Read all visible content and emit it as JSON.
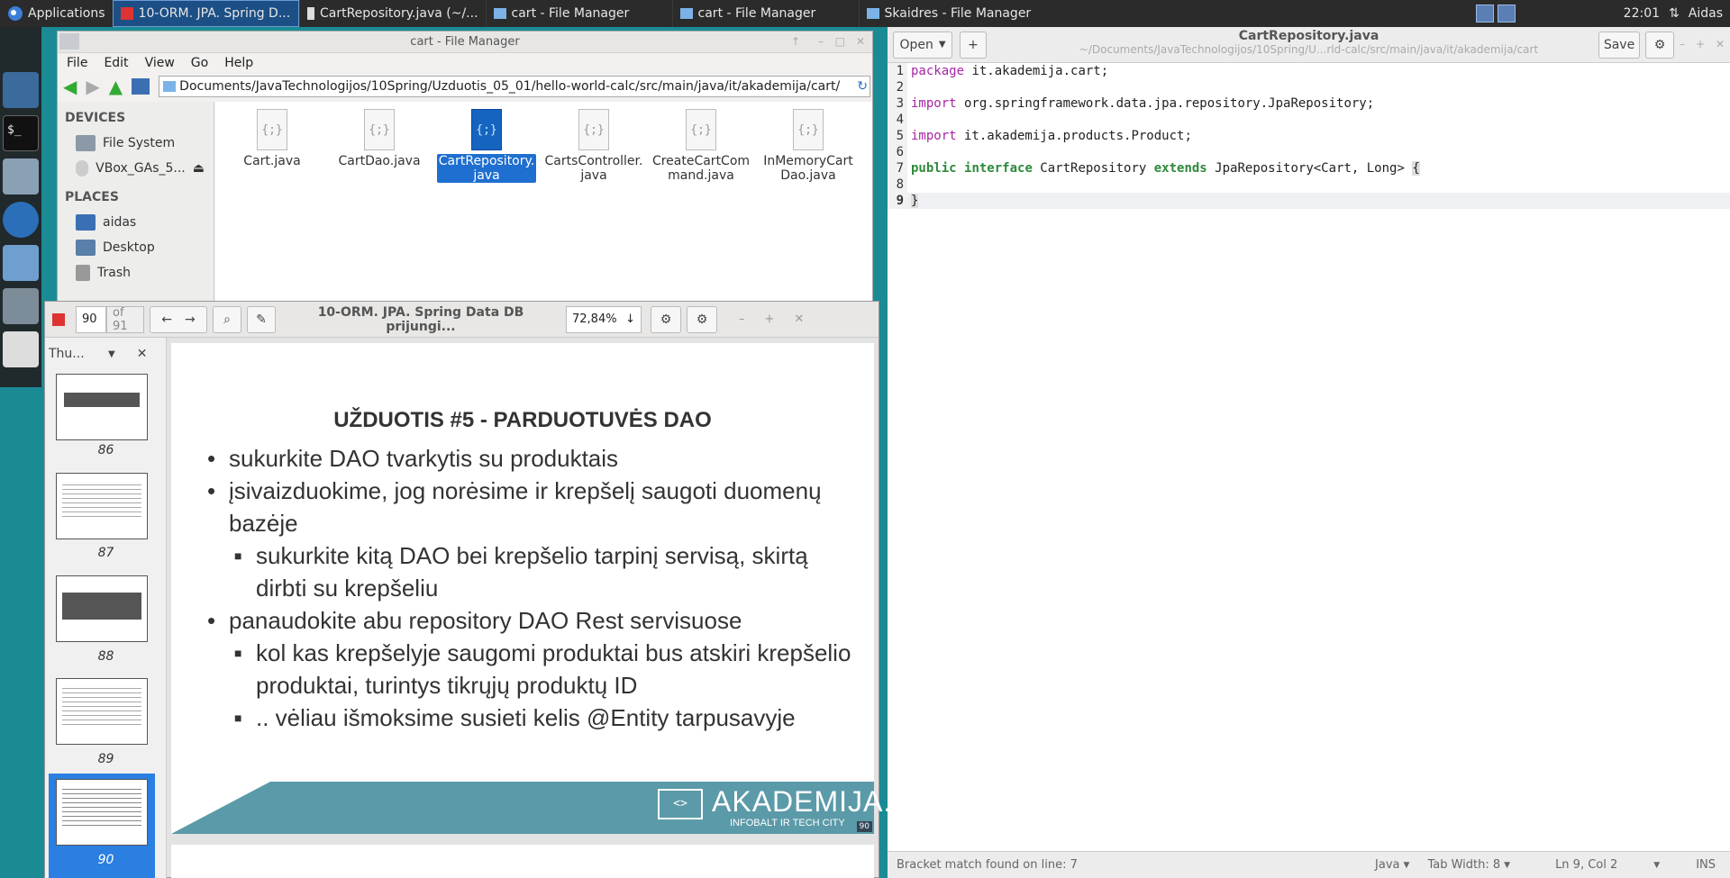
{
  "panel": {
    "apps": "Applications",
    "tasks": [
      "10-ORM. JPA. Spring D...",
      "CartRepository.java (~/...",
      "cart - File Manager",
      "cart - File Manager",
      "Skaidres - File Manager"
    ],
    "clock": "22:01",
    "user": "Aidas"
  },
  "fm": {
    "title": "cart - File Manager",
    "menu": [
      "File",
      "Edit",
      "View",
      "Go",
      "Help"
    ],
    "path": "Documents/JavaTechnologijos/10Spring/Uzduotis_05_01/hello-world-calc/src/main/java/it/akademija/cart/",
    "devices_header": "DEVICES",
    "places_header": "PLACES",
    "devices": [
      "File System",
      "VBox_GAs_5..."
    ],
    "places": [
      "aidas",
      "Desktop",
      "Trash"
    ],
    "file_icon_glyph": "{;}",
    "files": [
      "Cart.java",
      "CartDao.java",
      "CartRepository.java",
      "CartsController.java",
      "CreateCartCommand.java",
      "InMemoryCartDao.java"
    ]
  },
  "editor": {
    "title": "CartRepository.java",
    "subtitle": "~/Documents/JavaTechnologijos/10Spring/U...rld-calc/src/main/java/it/akademija/cart",
    "open": "Open",
    "save": "Save",
    "lines": [
      "package it.akademija.cart;",
      "",
      "import org.springframework.data.jpa.repository.JpaRepository;",
      "",
      "import it.akademija.products.Product;",
      "",
      "public interface CartRepository extends JpaRepository<Cart, Long> {",
      "",
      "}"
    ],
    "status": {
      "msg": "Bracket match found on line: 7",
      "lang": "Java",
      "tab": "Tab Width: 8",
      "pos": "Ln 9, Col 2",
      "ins": "INS"
    }
  },
  "pdf": {
    "page": "90",
    "of": "of 91",
    "title": "10-ORM. JPA. Spring Data DB prijungi...",
    "zoom": "72,84%",
    "side_label": "Thu...",
    "thumbs": [
      "86",
      "87",
      "88",
      "89",
      "90"
    ],
    "slide": {
      "heading": "UŽDUOTIS #5 - PARDUOTUVĖS DAO",
      "b1": "sukurkite DAO tvarkytis su produktais",
      "b2": "įsivaizduokime, jog norėsime ir krepšelį saugoti duomenų bazėje",
      "b2a": "sukurkite kitą DAO bei krepšelio tarpinį servisą, skirtą dirbti su krepšeliu",
      "b3": "panaudokite abu repository DAO Rest servisuose",
      "b3a": "kol kas krepšelyje saugomi produktai bus atskiri krepšelio produktai, turintys tikrųjų produktų ID",
      "b3b": ".. vėliau išmoksime susieti kelis @Entity tarpusavyje",
      "brand": "AKADEMIJA.IT",
      "tagline": "INFOBALT IR TECH CITY",
      "pnum": "90"
    }
  }
}
